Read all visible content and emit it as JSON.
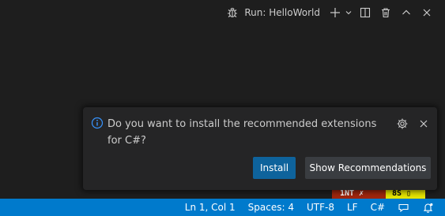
{
  "toolbar": {
    "run_label": "Run: HelloWorld",
    "icons": [
      "debug-icon",
      "add-icon",
      "chevron-down-icon",
      "split-icon",
      "trash-icon",
      "chevron-up-icon",
      "close-icon"
    ]
  },
  "notification": {
    "message": "Do you want to install the recommended extensions for C#?",
    "install_label": "Install",
    "show_label": "Show Recommendations",
    "accent": "#3794ff"
  },
  "peek": {
    "red_text": "1NT ✗",
    "yellow_text": "8S ▯"
  },
  "statusbar": {
    "position": "Ln 1, Col 1",
    "spaces": "Spaces: 4",
    "encoding": "UTF-8",
    "eol": "LF",
    "language": "C#",
    "color": "#007acc"
  }
}
